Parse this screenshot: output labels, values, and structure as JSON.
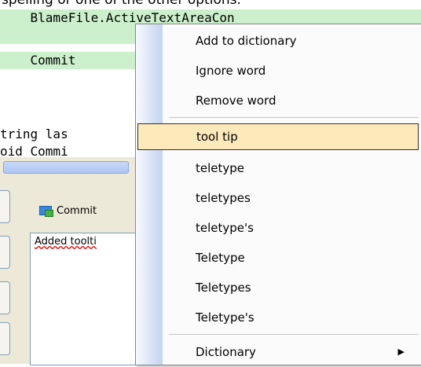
{
  "caption": "spelling or one of the other options.",
  "code": {
    "lines": [
      "    BlameFile.ActiveTextAreaCon",
      "",
      "    Commit",
      "",
      "tring las",
      "oid Commi"
    ]
  },
  "commit_pane": {
    "commit_label": "Commit",
    "message_text": "Added toolti"
  },
  "context_menu": {
    "items_top": [
      {
        "label": "Add to dictionary"
      },
      {
        "label": "Ignore word"
      },
      {
        "label": "Remove word"
      }
    ],
    "suggestions": [
      {
        "label": "tool tip",
        "selected": true
      },
      {
        "label": "teletype"
      },
      {
        "label": "teletypes"
      },
      {
        "label": "teletype's"
      },
      {
        "label": "Teletype"
      },
      {
        "label": "Teletypes"
      },
      {
        "label": "Teletype's"
      }
    ],
    "items_bottom": [
      {
        "label": "Dictionary",
        "submenu_icon": "right-triangle-icon"
      }
    ]
  },
  "colors": {
    "highlight_selection": "#fde9b9",
    "code_highlight": "#ccf0cc",
    "menu_gutter": "#c4d3ef"
  }
}
